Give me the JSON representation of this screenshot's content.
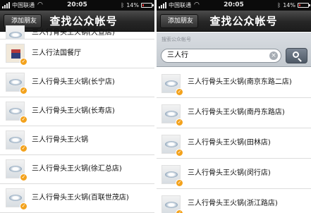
{
  "status_bar": {
    "carrier": "中国联通",
    "time": "20:05",
    "battery": "14%"
  },
  "nav": {
    "back_label": "添加朋友",
    "title": "查找公众帐号"
  },
  "left_list": [
    {
      "name": "三人行骨头王火锅(大宣店)",
      "logo": false,
      "partial": true
    },
    {
      "name": "三人行法国餐厅",
      "logo": true
    },
    {
      "name": "三人行骨头王火锅(长宁店)",
      "logo": false
    },
    {
      "name": "三人行骨头王火锅(长寿店)",
      "logo": false
    },
    {
      "name": "三人行骨头王火锅",
      "logo": false
    },
    {
      "name": "三人行骨头王火锅(徐汇总店)",
      "logo": false
    },
    {
      "name": "三人行骨头王火锅(百联世茂店)",
      "logo": false
    }
  ],
  "search": {
    "hint": "搜索公众帐号",
    "value": "三人行"
  },
  "right_list": [
    {
      "name": "三人行骨头王火锅(南京东路二店)"
    },
    {
      "name": "三人行骨头王火锅(南丹东路店)"
    },
    {
      "name": "三人行骨头王火锅(田林店)"
    },
    {
      "name": "三人行骨头王火锅(闵行店)"
    },
    {
      "name": "三人行骨头王火锅(浙江路店)"
    }
  ],
  "icons": {
    "verified": "verified-badge-icon",
    "clear": "clear-icon",
    "search": "search-icon"
  },
  "colors": {
    "navbar": "#262626",
    "verified_badge": "#f3a21c",
    "search_bar": "#c9cfd5"
  }
}
